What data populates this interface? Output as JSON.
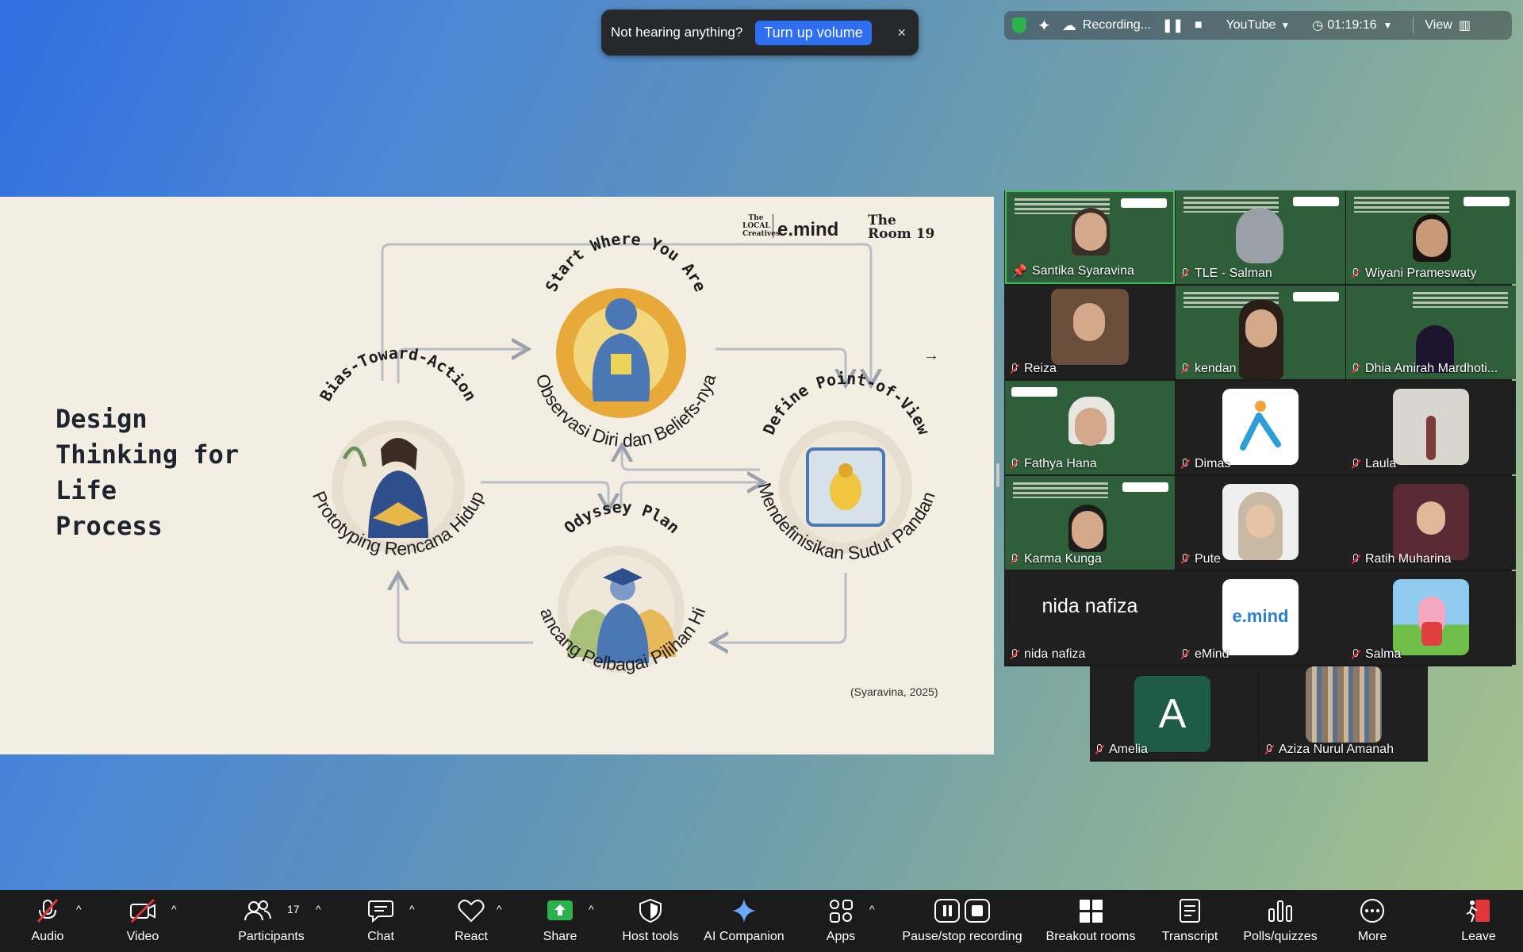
{
  "notification": {
    "message": "Not hearing anything?",
    "action_label": "Turn up volume",
    "close_label": "×"
  },
  "topbar": {
    "recording_label": "Recording...",
    "stream_label": "YouTube",
    "timer": "01:19:16",
    "view_label": "View"
  },
  "slide": {
    "title_lines": [
      "Design",
      "Thinking for",
      "Life",
      "Process"
    ],
    "logos": {
      "local": "The LOCAL Creatives",
      "emind": "e.mind",
      "room": "The Room 19"
    },
    "stages": {
      "start_title": "Start Where You Are",
      "start_sub": "Observasi Diri dan Beliefs-nya",
      "define_title": "Define Point-of-View",
      "define_sub": "Mendefinisikan Sudut Pandang",
      "odyssey_title": "Odyssey Plan",
      "odyssey_sub": "Merancang Pelbagai Pilihan Hidup",
      "bias_title": "Bias-Toward-Action",
      "bias_sub": "Prototyping Rencana Hidup"
    },
    "citation": "(Syaravina, 2025)",
    "next_arrow": "→"
  },
  "participants": [
    {
      "name": "Santika Syaravina"
    },
    {
      "name": "TLE - Salman"
    },
    {
      "name": "Wiyani Prameswaty"
    },
    {
      "name": "Reiza"
    },
    {
      "name": "kendan"
    },
    {
      "name": "Dhia Amirah Mardhoti..."
    },
    {
      "name": "Fathya Hana"
    },
    {
      "name": "Dimas"
    },
    {
      "name": "Laula"
    },
    {
      "name": "Karma Kunga"
    },
    {
      "name": "Pute"
    },
    {
      "name": "Ratih Muharina"
    },
    {
      "name": "nida nafiza",
      "display_text": "nida nafiza"
    },
    {
      "name": "eMind",
      "display_text": "e.mind"
    },
    {
      "name": "Salma"
    },
    {
      "name": "Amelia",
      "display_text": "A"
    },
    {
      "name": "Aziza Nurul Amanah"
    }
  ],
  "toolbar": {
    "audio": "Audio",
    "video": "Video",
    "participants": "Participants",
    "participants_count": "17",
    "chat": "Chat",
    "react": "React",
    "share": "Share",
    "host_tools": "Host tools",
    "ai_companion": "AI Companion",
    "apps": "Apps",
    "pause_stop": "Pause/stop recording",
    "breakout": "Breakout rooms",
    "transcript": "Transcript",
    "polls": "Polls/quizzes",
    "more": "More",
    "leave": "Leave"
  },
  "colors": {
    "accent_blue": "#2d6ff0",
    "share_green": "#2bb24c",
    "leave_red": "#e0353a",
    "speaker_border": "#3fbf5a"
  }
}
